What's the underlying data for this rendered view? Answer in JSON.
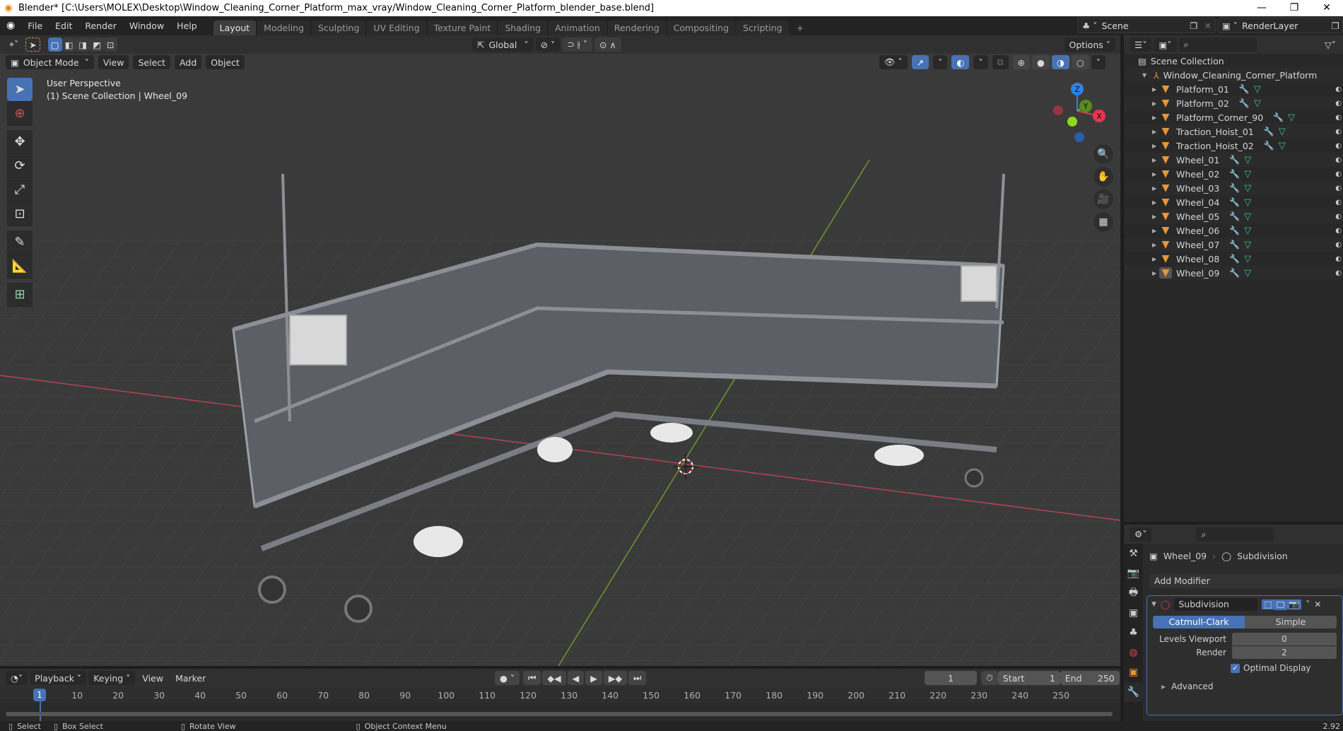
{
  "window": {
    "title": "Blender* [C:\\Users\\MOLEX\\Desktop\\Window_Cleaning_Corner_Platform_max_vray/Window_Cleaning_Corner_Platform_blender_base.blend]",
    "minimize": "—",
    "maximize": "❐",
    "close": "✕"
  },
  "menus": [
    "File",
    "Edit",
    "Render",
    "Window",
    "Help"
  ],
  "workspaces": [
    "Layout",
    "Modeling",
    "Sculpting",
    "UV Editing",
    "Texture Paint",
    "Shading",
    "Animation",
    "Rendering",
    "Compositing",
    "Scripting"
  ],
  "active_workspace": "Layout",
  "add_workspace": "+",
  "scene": {
    "name": "Scene",
    "view_layer": "RenderLayer"
  },
  "toolheader": {
    "transform_orientation": "Global",
    "options": "Options"
  },
  "viewport": {
    "mode": "Object Mode",
    "menu": [
      "View",
      "Select",
      "Add",
      "Object"
    ],
    "perspective": "User Perspective",
    "context": "(1) Scene Collection | Wheel_09",
    "gizmo": {
      "x": "X",
      "y": "Y",
      "z": "Z"
    },
    "colors": {
      "x_axis": "#d9404f",
      "y_axis": "#7cb82f",
      "z_axis": "#2f83e8"
    }
  },
  "tools": [
    "select-box",
    "cursor",
    "move",
    "rotate",
    "scale",
    "transform",
    "annotate",
    "measure",
    "add-cube"
  ],
  "outliner": {
    "root": "Scene Collection",
    "collection": "Window_Cleaning_Corner_Platform",
    "objects": [
      "Platform_01",
      "Platform_02",
      "Platform_Corner_90",
      "Traction_Hoist_01",
      "Traction_Hoist_02",
      "Wheel_01",
      "Wheel_02",
      "Wheel_03",
      "Wheel_04",
      "Wheel_05",
      "Wheel_06",
      "Wheel_07",
      "Wheel_08",
      "Wheel_09"
    ],
    "active_object": "Wheel_09"
  },
  "properties": {
    "breadcrumb_object": "Wheel_09",
    "breadcrumb_modifier": "Subdivision",
    "add_modifier": "Add Modifier",
    "modifier_name": "Subdivision",
    "type_options": [
      "Catmull-Clark",
      "Simple"
    ],
    "active_type": "Catmull-Clark",
    "levels_viewport_label": "Levels Viewport",
    "levels_viewport": "0",
    "render_label": "Render",
    "render": "2",
    "optimal_display_label": "Optimal Display",
    "optimal_display": true,
    "advanced": "Advanced"
  },
  "timeline": {
    "menu": [
      "Playback",
      "Keying",
      "View",
      "Marker"
    ],
    "current_frame": "1",
    "start_label": "Start",
    "start": "1",
    "end_label": "End",
    "end": "250",
    "ticks": [
      "10",
      "20",
      "30",
      "40",
      "50",
      "60",
      "70",
      "80",
      "90",
      "100",
      "110",
      "120",
      "130",
      "140",
      "150",
      "160",
      "170",
      "180",
      "190",
      "200",
      "210",
      "220",
      "230",
      "240",
      "250"
    ]
  },
  "statusbar": {
    "select": "Select",
    "box_select": "Box Select",
    "rotate_view": "Rotate View",
    "context_menu": "Object Context Menu",
    "version": "2.92"
  }
}
